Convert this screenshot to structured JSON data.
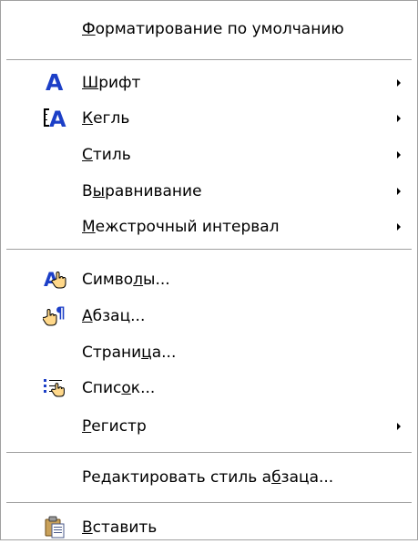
{
  "menu": {
    "items": [
      {
        "id": "default-formatting",
        "pre": "",
        "u": "Ф",
        "post": "орматирование по умолчанию",
        "icon": "",
        "submenu": false
      },
      {
        "id": "font",
        "pre": "",
        "u": "Ш",
        "post": "рифт",
        "icon": "font-letter-a-icon",
        "submenu": true
      },
      {
        "id": "font-size",
        "pre": "",
        "u": "К",
        "post": "егль",
        "icon": "font-size-icon",
        "submenu": true
      },
      {
        "id": "style",
        "pre": "",
        "u": "С",
        "post": "тиль",
        "icon": "",
        "submenu": true
      },
      {
        "id": "alignment",
        "pre": "В",
        "u": "ы",
        "post": "равнивание",
        "icon": "",
        "submenu": true
      },
      {
        "id": "line-spacing",
        "pre": "",
        "u": "М",
        "post": "ежстрочный интервал",
        "icon": "",
        "submenu": true
      },
      {
        "id": "characters",
        "pre": "Симво",
        "u": "л",
        "post": "ы...",
        "icon": "character-format-icon",
        "submenu": false
      },
      {
        "id": "paragraph",
        "pre": "",
        "u": "А",
        "post": "бзац...",
        "icon": "paragraph-format-icon",
        "submenu": false
      },
      {
        "id": "page",
        "pre": "Страни",
        "u": "ц",
        "post": "а...",
        "icon": "",
        "submenu": false
      },
      {
        "id": "list",
        "pre": "Спис",
        "u": "о",
        "post": "к...",
        "icon": "list-format-icon",
        "submenu": false
      },
      {
        "id": "case",
        "pre": "",
        "u": "Р",
        "post": "егистр",
        "icon": "",
        "submenu": true
      },
      {
        "id": "edit-paragraph-style",
        "pre": "Редактировать стиль а",
        "u": "б",
        "post": "заца...",
        "icon": "",
        "submenu": false
      },
      {
        "id": "paste",
        "pre": "",
        "u": "В",
        "post": "ставить",
        "icon": "paste-icon",
        "submenu": false
      }
    ]
  }
}
